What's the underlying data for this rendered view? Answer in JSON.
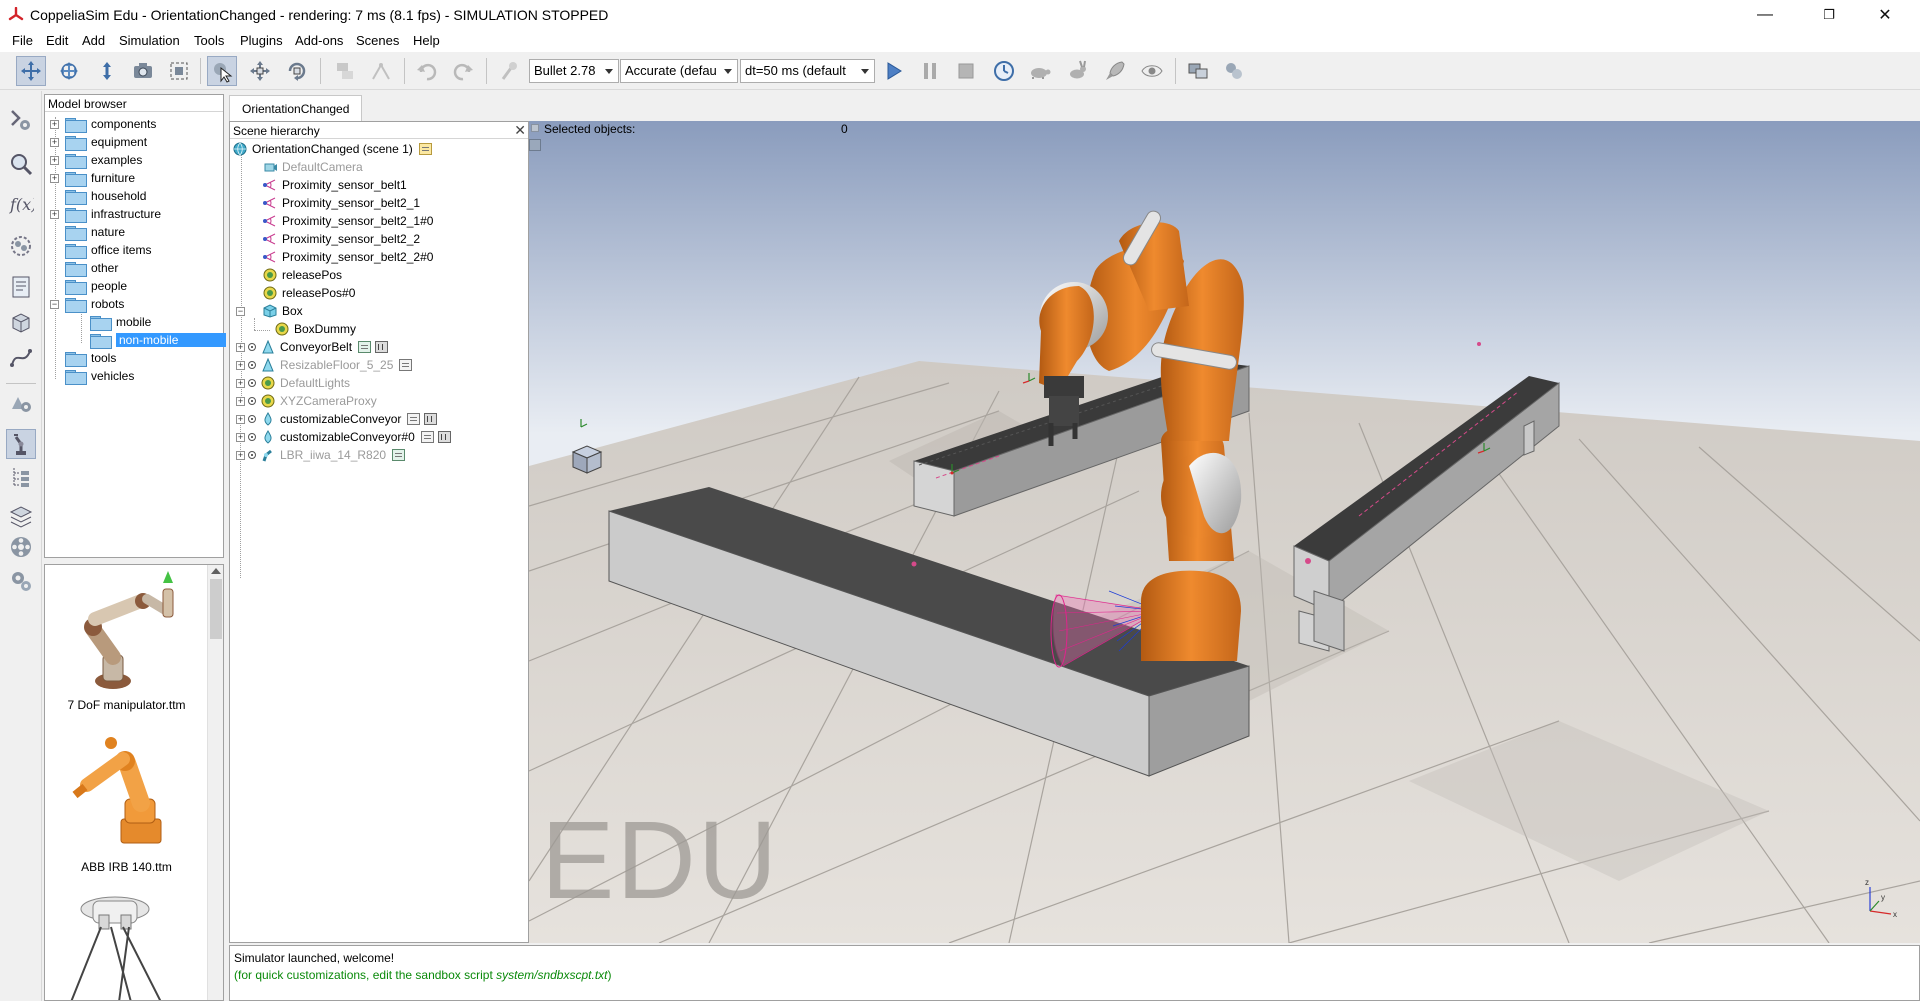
{
  "window": {
    "title": "CoppeliaSim Edu - OrientationChanged - rendering: 7 ms (8.1 fps) - SIMULATION STOPPED",
    "minimize": "—",
    "maximize": "❐",
    "close": "✕"
  },
  "menu": [
    "File",
    "Edit",
    "Add",
    "Simulation",
    "Tools",
    "Plugins",
    "Add-ons",
    "Scenes",
    "Help"
  ],
  "toolbar": {
    "engine": "Bullet 2.78",
    "accuracy": "Accurate (defau",
    "dt": "dt=50 ms (default"
  },
  "model_browser": {
    "title": "Model browser",
    "folders": [
      "components",
      "equipment",
      "examples",
      "furniture",
      "household",
      "infrastructure",
      "nature",
      "office items",
      "other",
      "people",
      "robots",
      "mobile",
      "non-mobile",
      "tools",
      "vehicles"
    ]
  },
  "thumbnails": [
    "7 DoF manipulator.ttm",
    "ABB IRB 140.ttm"
  ],
  "scene_tab": "OrientationChanged",
  "scene_hierarchy": {
    "title": "Scene hierarchy",
    "close": "✕",
    "items": [
      "OrientationChanged (scene 1)",
      "DefaultCamera",
      "Proximity_sensor_belt1",
      "Proximity_sensor_belt2_1",
      "Proximity_sensor_belt2_1#0",
      "Proximity_sensor_belt2_2",
      "Proximity_sensor_belt2_2#0",
      "releasePos",
      "releasePos#0",
      "Box",
      "BoxDummy",
      "ConveyorBelt",
      "ResizableFloor_5_25",
      "DefaultLights",
      "XYZCameraProxy",
      "customizableConveyor",
      "customizableConveyor#0",
      "LBR_iiwa_14_R820"
    ]
  },
  "selection": {
    "label": "Selected objects:",
    "count": "0"
  },
  "viewport": {
    "watermark": "EDU",
    "sky_top": "#8a9cbd",
    "sky_bottom": "#e9edf3",
    "robot_orange": "#e87a22"
  },
  "console": {
    "line1": "Simulator launched, welcome!",
    "line2_prefix": "(for quick customizations, edit the sandbox script ",
    "line2_file": "system/sndbxscpt.txt",
    "line2_suffix": ")"
  }
}
